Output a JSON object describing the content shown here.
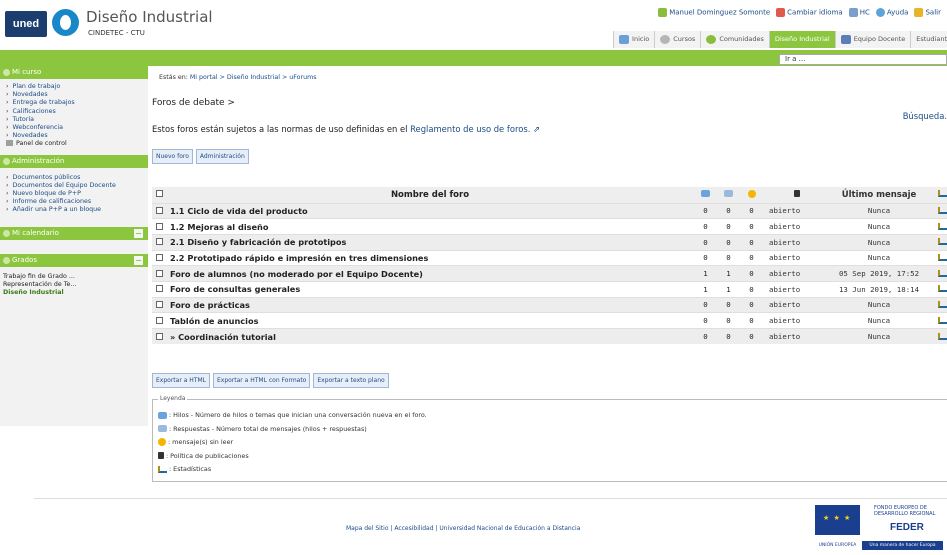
{
  "header": {
    "logo_text": "uned",
    "site_title": "Diseño Industrial",
    "site_subtitle": "CINDETEC - CTU",
    "user_links": [
      {
        "label": "Manuel Dominguez Somonte",
        "icon": "user-icon",
        "color": "#8bbd3c"
      },
      {
        "label": "Cambiar idioma",
        "icon": "language-icon",
        "color": "#e05a4c"
      },
      {
        "label": "HC",
        "icon": "help-center-icon",
        "color": "#7a9fc9"
      },
      {
        "label": "Ayuda",
        "icon": "help-icon",
        "color": "#5fa4d6"
      },
      {
        "label": "Salir",
        "icon": "exit-icon",
        "color": "#e7b42a"
      }
    ],
    "tabs": [
      {
        "label": "Inicio",
        "icon": "home-icon",
        "color": "#6a9fd8",
        "active": false
      },
      {
        "label": "Cursos",
        "icon": "courses-icon",
        "color": "#b5b5b5",
        "active": false
      },
      {
        "label": "Comunidades",
        "icon": "communities-icon",
        "color": "#8bbd3c",
        "active": false
      },
      {
        "label": "Diseño Industrial",
        "icon": "",
        "color": "",
        "active": true
      },
      {
        "label": "Equipo Docente",
        "icon": "teachers-icon",
        "color": "#5a7fb8",
        "active": false
      },
      {
        "label": "Estudiant",
        "icon": "",
        "color": "",
        "active": false
      }
    ],
    "goto_label": "Ir a ..."
  },
  "sidebar": {
    "mi_curso": {
      "title": "Mi curso",
      "items": [
        "Plan de trabajo",
        "Novedades",
        "Entrega de trabajos",
        "Calificaciones",
        "Tutoría",
        "Webconferencia",
        "Novedades"
      ],
      "panel": "Panel de control"
    },
    "administracion": {
      "title": "Administración",
      "items": [
        "Documentos públicos",
        "Documentos del Equipo Docente",
        "Nuevo bloque de P+P",
        "Informe de calificaciones",
        "Añadir una P+P a un bloque"
      ]
    },
    "calendario": {
      "title": "Mi calendario"
    },
    "grados": {
      "title": "Grados",
      "items": [
        "Trabajo fin de Grado ...",
        "Representación de Te...",
        "Diseño Industrial"
      ]
    }
  },
  "main": {
    "breadcrumb_prefix": "Estás en:",
    "breadcrumb": "Mi portal > Diseño Industrial > uForums",
    "heading": "Foros de debate >",
    "notice_text": "Estos foros están sujetos a las normas de uso definidas en el",
    "notice_link": "Reglamento de uso de foros.",
    "search_link": "Búsqueda.",
    "buttons": {
      "new_forum": "Nuevo foro",
      "admin": "Administración"
    },
    "table": {
      "col_name": "Nombre del foro",
      "col_last": "Último mensaje",
      "rows": [
        {
          "name": "1.1 Ciclo de vida del producto",
          "threads": "0",
          "replies": "0",
          "unread": "0",
          "status": "abierto",
          "last": "Nunca"
        },
        {
          "name": "1.2 Mejoras al diseño",
          "threads": "0",
          "replies": "0",
          "unread": "0",
          "status": "abierto",
          "last": "Nunca"
        },
        {
          "name": "2.1 Diseño y fabricación de prototipos",
          "threads": "0",
          "replies": "0",
          "unread": "0",
          "status": "abierto",
          "last": "Nunca"
        },
        {
          "name": "2.2 Prototipado rápido e impresión en tres dimensiones",
          "threads": "0",
          "replies": "0",
          "unread": "0",
          "status": "abierto",
          "last": "Nunca"
        },
        {
          "name": "Foro de alumnos (no moderado por el Equipo Docente)",
          "threads": "1",
          "replies": "1",
          "unread": "0",
          "status": "abierto",
          "last": "05 Sep 2019, 17:52"
        },
        {
          "name": "Foro de consultas generales",
          "threads": "1",
          "replies": "1",
          "unread": "0",
          "status": "abierto",
          "last": "13 Jun 2019, 18:14"
        },
        {
          "name": "Foro de prácticas",
          "threads": "0",
          "replies": "0",
          "unread": "0",
          "status": "abierto",
          "last": "Nunca"
        },
        {
          "name": "Tablón de anuncios",
          "threads": "0",
          "replies": "0",
          "unread": "0",
          "status": "abierto",
          "last": "Nunca"
        },
        {
          "name": "» Coordinación tutorial",
          "threads": "0",
          "replies": "0",
          "unread": "0",
          "status": "abierto",
          "last": "Nunca"
        }
      ]
    },
    "export_buttons": [
      "Exportar a HTML",
      "Exportar a HTML con Formato",
      "Exportar a texto plano"
    ],
    "legend": {
      "caption": "Leyenda",
      "items": [
        ": Hilos - Número de hilos o temas que inician una conversación nueva en el foro.",
        ": Respuestas - Número total de mensajes (hilos + respuestas)",
        ": mensaje(s) sin leer",
        ": Política de publicaciones",
        ": Estadísticas"
      ]
    }
  },
  "footer": {
    "links": "Mapa del Sitio | Accesibilidad | Universidad Nacional de Educación a Distancia",
    "feder_small": "FONDO EUROPEO DE DESARROLLO REGIONAL",
    "feder_big": "FEDER",
    "eu_label": "UNIÓN EUROPEA",
    "slogan": "Una manera de hacer Europa"
  }
}
